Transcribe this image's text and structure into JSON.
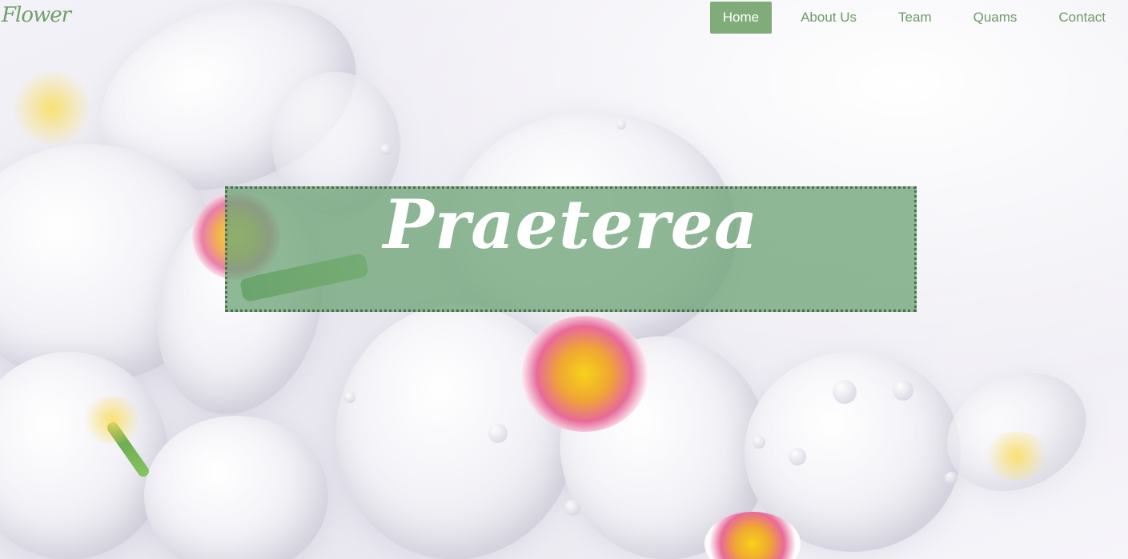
{
  "brand": {
    "logo_text": "Flower",
    "accent_color": "#7fac78"
  },
  "nav": {
    "items": [
      {
        "label": "Home",
        "active": true
      },
      {
        "label": "About Us",
        "active": false
      },
      {
        "label": "Team",
        "active": false
      },
      {
        "label": "Quams",
        "active": false
      },
      {
        "label": "Contact",
        "active": false
      }
    ]
  },
  "hero": {
    "title": "Praeterea",
    "background": "white-orchids-photo"
  }
}
